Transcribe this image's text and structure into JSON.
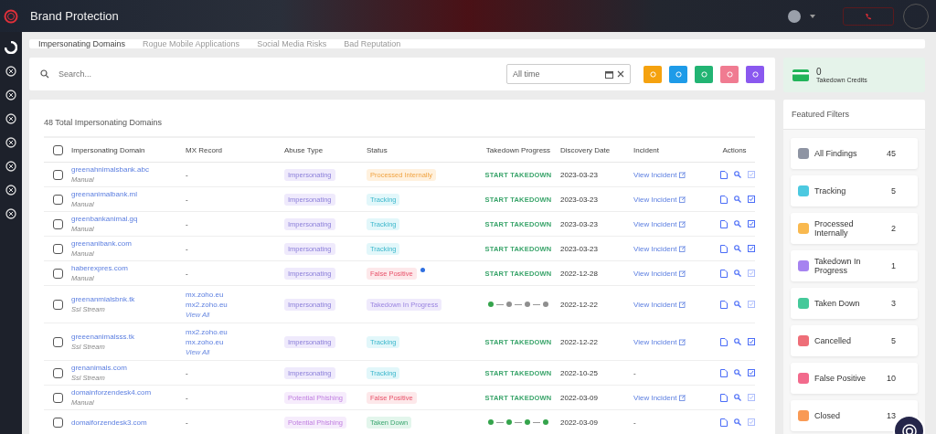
{
  "header": {
    "title": "Brand Protection"
  },
  "tabs": [
    {
      "label": "Impersonating Domains",
      "selected": true
    },
    {
      "label": "Rogue Mobile Applications",
      "selected": false
    },
    {
      "label": "Social Media Risks",
      "selected": false
    },
    {
      "label": "Bad Reputation",
      "selected": false
    }
  ],
  "search": {
    "placeholder": "Search..."
  },
  "date_filter": {
    "value": "All time"
  },
  "credits": {
    "count": "0",
    "label": "Takedown Credits"
  },
  "table": {
    "title": "48 Total Impersonating Domains",
    "all_checked": false,
    "columns": [
      "Impersonating Domain",
      "MX Record",
      "Abuse Type",
      "Status",
      "Takedown Progress",
      "Discovery Date",
      "Incident",
      "Actions"
    ],
    "rows": [
      {
        "checked": false,
        "domain": "greenahnimalsbank.abc",
        "source": "Manual",
        "mx": [
          "-"
        ],
        "abuse": {
          "label": "Impersonating",
          "kind": "impersonating"
        },
        "status": {
          "label": "Processed Internally",
          "kind": "processed"
        },
        "info": false,
        "progress": {
          "kind": "button",
          "label": "START TAKEDOWN"
        },
        "date": "2023-03-23",
        "incident": {
          "text": "View Incident",
          "link": true
        },
        "review_active": false
      },
      {
        "checked": false,
        "domain": "greenanimalbank.ml",
        "source": "Manual",
        "mx": [
          "-"
        ],
        "abuse": {
          "label": "Impersonating",
          "kind": "impersonating"
        },
        "status": {
          "label": "Tracking",
          "kind": "tracking"
        },
        "info": false,
        "progress": {
          "kind": "button",
          "label": "START TAKEDOWN"
        },
        "date": "2023-03-23",
        "incident": {
          "text": "View Incident",
          "link": true
        },
        "review_active": true
      },
      {
        "checked": false,
        "domain": "greenbankanimal.gq",
        "source": "Manual",
        "mx": [
          "-"
        ],
        "abuse": {
          "label": "Impersonating",
          "kind": "impersonating"
        },
        "status": {
          "label": "Tracking",
          "kind": "tracking"
        },
        "info": false,
        "progress": {
          "kind": "button",
          "label": "START TAKEDOWN"
        },
        "date": "2023-03-23",
        "incident": {
          "text": "View Incident",
          "link": true
        },
        "review_active": true
      },
      {
        "checked": false,
        "domain": "greenanibank.com",
        "source": "Manual",
        "mx": [
          "-"
        ],
        "abuse": {
          "label": "Impersonating",
          "kind": "impersonating"
        },
        "status": {
          "label": "Tracking",
          "kind": "tracking"
        },
        "info": false,
        "progress": {
          "kind": "button",
          "label": "START TAKEDOWN"
        },
        "date": "2023-03-23",
        "incident": {
          "text": "View Incident",
          "link": true
        },
        "review_active": true
      },
      {
        "checked": false,
        "domain": "haberexpres.com",
        "source": "Manual",
        "mx": [
          "-"
        ],
        "abuse": {
          "label": "Impersonating",
          "kind": "impersonating"
        },
        "status": {
          "label": "False Positive",
          "kind": "false_positive"
        },
        "info": true,
        "progress": {
          "kind": "button",
          "label": "START TAKEDOWN"
        },
        "date": "2022-12-28",
        "incident": {
          "text": "View Incident",
          "link": true
        },
        "review_active": false
      },
      {
        "checked": false,
        "domain": "greenanmialsbnk.tk",
        "source": "Ssl Stream",
        "mx": [
          "mx.zoho.eu",
          "mx2.zoho.eu"
        ],
        "view_all": "View All",
        "abuse": {
          "label": "Impersonating",
          "kind": "impersonating"
        },
        "status": {
          "label": "Takedown In Progress",
          "kind": "in_progress"
        },
        "info": false,
        "progress": {
          "kind": "steps",
          "steps": [
            {
              "done": true
            },
            {
              "done": false
            },
            {
              "done": false
            },
            {
              "done": false
            }
          ]
        },
        "date": "2022-12-22",
        "incident": {
          "text": "View Incident",
          "link": true
        },
        "review_active": false
      },
      {
        "checked": false,
        "domain": "greeenanimalsss.tk",
        "source": "Ssl Stream",
        "mx": [
          "mx2.zoho.eu",
          "mx.zoho.eu"
        ],
        "view_all": "View All",
        "abuse": {
          "label": "Impersonating",
          "kind": "impersonating"
        },
        "status": {
          "label": "Tracking",
          "kind": "tracking"
        },
        "info": false,
        "progress": {
          "kind": "button",
          "label": "START TAKEDOWN"
        },
        "date": "2022-12-22",
        "incident": {
          "text": "View Incident",
          "link": true
        },
        "review_active": true
      },
      {
        "checked": false,
        "domain": "grenanimals.com",
        "source": "Ssl Stream",
        "mx": [
          "-"
        ],
        "abuse": {
          "label": "Impersonating",
          "kind": "impersonating"
        },
        "status": {
          "label": "Tracking",
          "kind": "tracking"
        },
        "info": false,
        "progress": {
          "kind": "button",
          "label": "START TAKEDOWN"
        },
        "date": "2022-10-25",
        "incident": {
          "text": "-",
          "link": false
        },
        "review_active": true
      },
      {
        "checked": false,
        "domain": "domainforzendesk4.com",
        "source": "Manual",
        "mx": [
          "-"
        ],
        "abuse": {
          "label": "Potential Phishing",
          "kind": "phishing"
        },
        "status": {
          "label": "False Positive",
          "kind": "false_positive"
        },
        "info": false,
        "progress": {
          "kind": "button",
          "label": "START TAKEDOWN"
        },
        "date": "2022-03-09",
        "incident": {
          "text": "View Incident",
          "link": true
        },
        "review_active": false
      },
      {
        "checked": false,
        "domain": "domaiforzendesk3.com",
        "mx": [
          "-"
        ],
        "abuse": {
          "label": "Potential Phishing",
          "kind": "phishing"
        },
        "status": {
          "label": "Taken Down",
          "kind": "taken_down"
        },
        "info": false,
        "progress": {
          "kind": "steps",
          "steps": [
            {
              "done": true
            },
            {
              "done": true
            },
            {
              "done": true
            },
            {
              "done": true
            }
          ]
        },
        "date": "2022-03-09",
        "incident": {
          "text": "-",
          "link": false
        },
        "review_active": false
      }
    ]
  },
  "filters": {
    "title": "Featured Filters",
    "items": [
      {
        "label": "All Findings",
        "count": "45",
        "color": "#8e94a3"
      },
      {
        "label": "Tracking",
        "count": "5",
        "color": "#4cc9e0"
      },
      {
        "label": "Processed Internally",
        "count": "2",
        "color": "#f9b94f"
      },
      {
        "label": "Takedown In Progress",
        "count": "1",
        "color": "#a683f0"
      },
      {
        "label": "Taken Down",
        "count": "3",
        "color": "#45c99a"
      },
      {
        "label": "Cancelled",
        "count": "5",
        "color": "#ee6e78"
      },
      {
        "label": "False Positive",
        "count": "10",
        "color": "#f26a8c"
      },
      {
        "label": "Closed",
        "count": "13",
        "color": "#f99a55"
      }
    ]
  }
}
